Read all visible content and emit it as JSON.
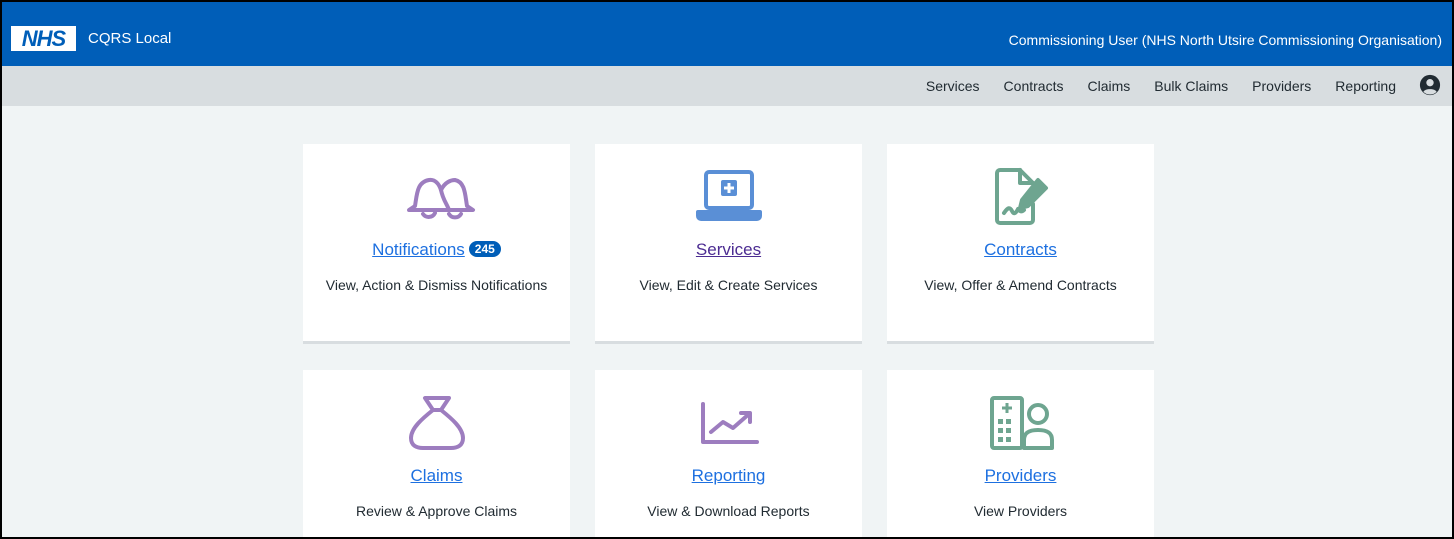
{
  "header": {
    "logo_text": "NHS",
    "app_name": "CQRS Local",
    "user_info": "Commissioning User (NHS North Utsire Commissioning Organisation)"
  },
  "nav": {
    "items": [
      "Services",
      "Contracts",
      "Claims",
      "Bulk Claims",
      "Providers",
      "Reporting"
    ],
    "account_icon": "account-circle-icon"
  },
  "cards": [
    {
      "title": "Notifications",
      "badge": "245",
      "description": "View, Action & Dismiss Notifications",
      "icon": "bell-icon",
      "title_color": "#1d70e0",
      "icon_color": "#9d7dbf"
    },
    {
      "title": "Services",
      "description": "View, Edit & Create Services",
      "icon": "laptop-plus-icon",
      "title_color": "#4c2c92",
      "icon_color": "#5a8fd6"
    },
    {
      "title": "Contracts",
      "description": "View, Offer & Amend Contracts",
      "icon": "contract-sign-icon",
      "title_color": "#1d70e0",
      "icon_color": "#6ea590"
    },
    {
      "title": "Claims",
      "description": "Review & Approve Claims",
      "icon": "money-bag-icon",
      "title_color": "#1d70e0",
      "icon_color": "#9d7dbf"
    },
    {
      "title": "Reporting",
      "description": "View & Download Reports",
      "icon": "chart-trend-icon",
      "title_color": "#1d70e0",
      "icon_color": "#9d7dbf"
    },
    {
      "title": "Providers",
      "description": "View Providers",
      "icon": "hospital-person-icon",
      "title_color": "#1d70e0",
      "icon_color": "#6ea590"
    }
  ]
}
